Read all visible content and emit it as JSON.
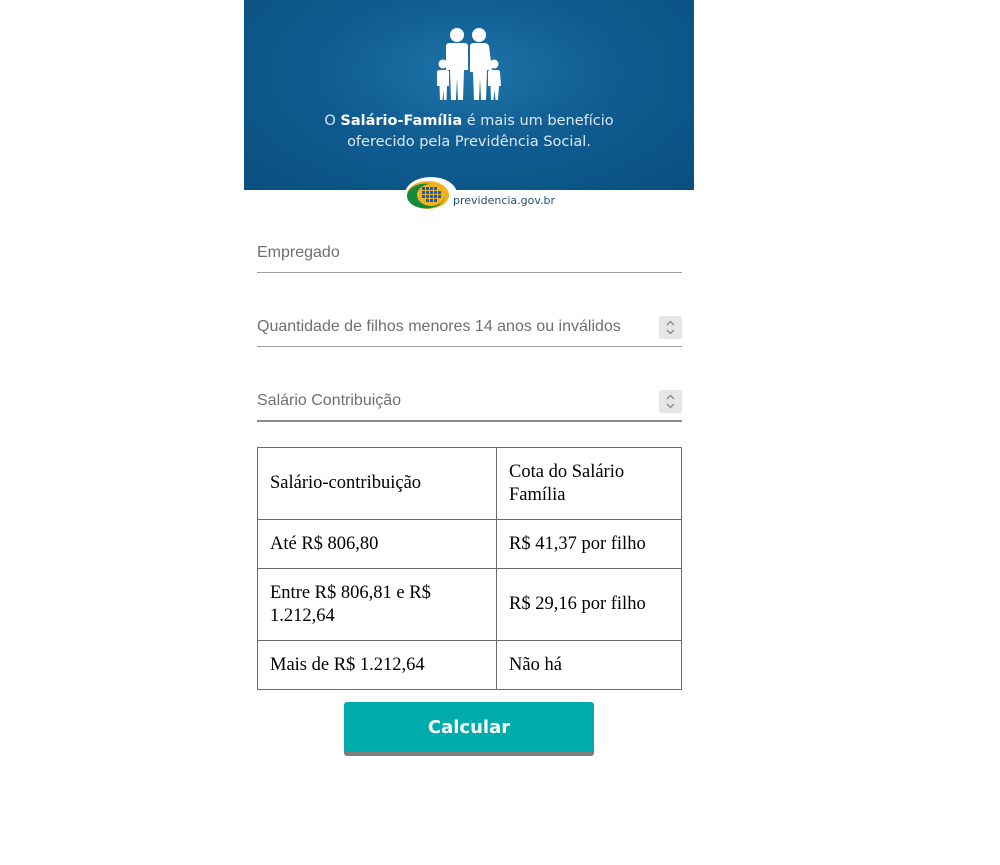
{
  "banner": {
    "text_prefix": "O ",
    "text_bold": "Salário-Família",
    "text_rest_line1": " é mais um benefício",
    "text_line2": "oferecido pela Previdência Social.",
    "logo_text": "previdencia.gov.br",
    "background_color": "#0f5c91"
  },
  "form": {
    "empregado_placeholder": "Empregado",
    "filhos_placeholder": "Quantidade de filhos menores 14 anos ou inválidos",
    "salario_placeholder": "Salário Contribuição"
  },
  "table": {
    "headers": [
      "Salário-contribuição",
      "Cota do Salário Família"
    ],
    "rows": [
      [
        "Até R$ 806,80",
        "R$ 41,37 por filho"
      ],
      [
        "Entre R$ 806,81 e R$ 1.212,64",
        "R$ 29,16 por filho"
      ],
      [
        "Mais de R$ 1.212,64",
        "Não há"
      ]
    ]
  },
  "button": {
    "label": "Calcular",
    "color": "#00abab"
  }
}
